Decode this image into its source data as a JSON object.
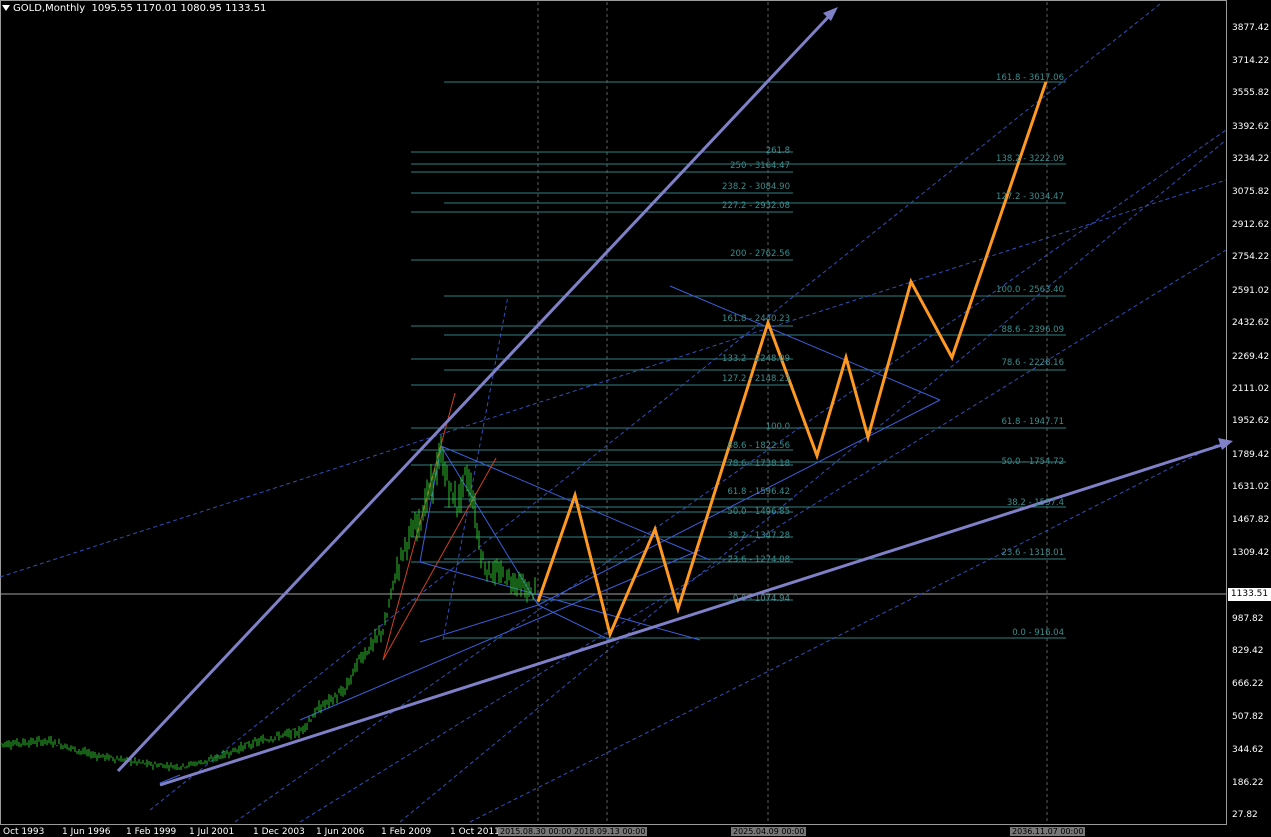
{
  "window": {
    "symbol_title": "GOLD,Monthly",
    "ohlc": "1095.55 1170.01 1080.95 1133.51"
  },
  "current_price": "1133.51",
  "price_axis": {
    "labels": [
      "3877.42",
      "3714.22",
      "3555.82",
      "3392.62",
      "3234.22",
      "3075.82",
      "2912.62",
      "2754.22",
      "2591.02",
      "2432.62",
      "2269.42",
      "2111.02",
      "1952.62",
      "1789.42",
      "1631.02",
      "1467.82",
      "1309.42",
      "1133.51",
      "987.82",
      "829.42",
      "666.22",
      "507.82",
      "344.62",
      "186.22",
      "27.82"
    ]
  },
  "time_axis": {
    "labels": [
      "Oct 1993",
      "1 Jun 1996",
      "1 Feb 1999",
      "1 Jul 2001",
      "1 Dec 2003",
      "1 Jun 2006",
      "1 Feb 2009",
      "1 Oct 2011"
    ],
    "highlighted": [
      "2015.08.30 00:00",
      "2018.09.13 00:00",
      "2025.04.09 00:00",
      "2036.11.07 00:00"
    ]
  },
  "fibo_left": [
    "261.8",
    "250 - 3164.47",
    "238.2 - 3084.90",
    "227.2 - 2932.08",
    "200 - 2762.56",
    "161.8 - 2440.23",
    "133.2 - 2248.09",
    "127.2 - 2148.23",
    "100.0",
    "88.6 - 1822.56",
    "78.6 - 1738.18",
    "61.8 - 1596.42",
    "50.0 - 1496.85",
    "38.2 - 1347.28",
    "23.6 - 1274.08",
    "0.0 - 1074.94"
  ],
  "fibo_right": [
    "161.8 - 3617.06",
    "138.2 - 3222.09",
    "127.2 - 3034.47",
    "100.0 - 2563.40",
    "88.6 - 2396.09",
    "78.6 - 2228.16",
    "61.8 - 1947.71",
    "50.0 - 1754.72",
    "38.2 - 1557.4",
    "23.6 - 1318.01",
    "0.0 - 916.04"
  ],
  "colors": {
    "background": "#000000",
    "bull_candle": "#2ebd2e",
    "projection": "#ff9922",
    "trendline": "#8080c8",
    "channel": "#3a5fd8",
    "fibo": "#2f7f7f",
    "fan": "#d04020"
  },
  "projection_path": [
    1074.94,
    1596.42,
    916.04,
    1430.0,
    1040.0,
    2440.23,
    1789.42,
    2269.42,
    1880.0,
    2640.0,
    2269.42,
    3617.06
  ],
  "icons": [
    "dropdown-arrow-icon"
  ]
}
